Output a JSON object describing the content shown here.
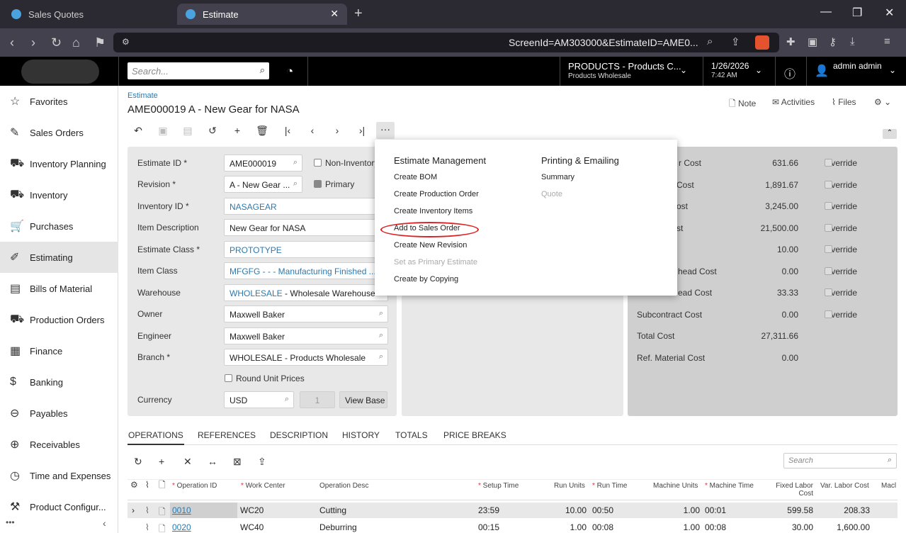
{
  "browser": {
    "tabs": [
      {
        "label": "Sales Quotes"
      },
      {
        "label": "Estimate"
      }
    ],
    "url_visible": "ScreenId=AM303000&EstimateID=AME0..."
  },
  "header": {
    "search_placeholder": "Search...",
    "company": "PRODUCTS - Products C...",
    "company_sub": "Products Wholesale",
    "date": "1/26/2026",
    "time": "7:42 AM",
    "user": "admin admin"
  },
  "sidebar": {
    "items": [
      {
        "label": "Favorites",
        "icon": "☆"
      },
      {
        "label": "Sales Orders",
        "icon": "✎"
      },
      {
        "label": "Inventory Planning",
        "icon": "⛟"
      },
      {
        "label": "Inventory",
        "icon": "⛟"
      },
      {
        "label": "Purchases",
        "icon": "🛒"
      },
      {
        "label": "Estimating",
        "icon": "✐"
      },
      {
        "label": "Bills of Material",
        "icon": "▤"
      },
      {
        "label": "Production Orders",
        "icon": "⛟"
      },
      {
        "label": "Finance",
        "icon": "▦"
      },
      {
        "label": "Banking",
        "icon": "$"
      },
      {
        "label": "Payables",
        "icon": "⊖"
      },
      {
        "label": "Receivables",
        "icon": "⊕"
      },
      {
        "label": "Time and Expenses",
        "icon": "◷"
      },
      {
        "label": "Product Configur...",
        "icon": "⚒"
      }
    ]
  },
  "page": {
    "breadcrumb": "Estimate",
    "title": "AME000019 A - New Gear for NASA",
    "actions": {
      "note": "Note",
      "activities": "Activities",
      "files": "Files"
    }
  },
  "form": {
    "estimate_id_label": "Estimate ID *",
    "estimate_id": "AME000019",
    "non_inventory_label": "Non-Inventory",
    "revision_label": "Revision *",
    "revision": "A - New Gear ...",
    "primary_label": "Primary",
    "inventory_id_label": "Inventory ID *",
    "inventory_id": "NASAGEAR",
    "item_desc_label": "Item Description",
    "item_desc": "New Gear for NASA",
    "estimate_class_label": "Estimate Class *",
    "estimate_class": "PROTOTYPE",
    "item_class_label": "Item Class",
    "item_class": "MFGFG - - - Manufacturing Finished ...",
    "warehouse_label": "Warehouse",
    "warehouse_code": "WHOLESALE",
    "warehouse_desc": " - Wholesale Warehouse",
    "owner_label": "Owner",
    "owner": "Maxwell Baker",
    "engineer_label": "Engineer",
    "engineer": "Maxwell Baker",
    "branch_label": "Branch *",
    "branch": "WHOLESALE - Products Wholesale",
    "round_label": "Round Unit Prices",
    "currency_label": "Currency",
    "currency": "USD",
    "rate": "1",
    "view_base": "View Base"
  },
  "costs": [
    {
      "label": "r Cost",
      "value": "631.66",
      "override": "Override"
    },
    {
      "label": "Cost",
      "value": "1,891.67",
      "override": "Override"
    },
    {
      "label": "ost",
      "value": "3,245.00",
      "override": "Override"
    },
    {
      "label": "st",
      "value": "21,500.00",
      "override": "Override"
    },
    {
      "label": "",
      "value": "10.00",
      "override": "Override"
    },
    {
      "label": "head Cost",
      "value": "0.00",
      "override": "Override"
    },
    {
      "label": "ead Cost",
      "value": "33.33",
      "override": "Override"
    },
    {
      "label": "Subcontract Cost",
      "value": "0.00",
      "override": "Override"
    },
    {
      "label": "Total Cost",
      "value": "27,311.66",
      "override": ""
    },
    {
      "label": "Ref. Material Cost",
      "value": "0.00",
      "override": ""
    }
  ],
  "menu": {
    "col1_title": "Estimate Management",
    "col1": [
      {
        "label": "Create BOM",
        "enabled": true
      },
      {
        "label": "Create Production Order",
        "enabled": true
      },
      {
        "label": "Create Inventory Items",
        "enabled": true
      },
      {
        "label": "Add to Sales Order",
        "enabled": true
      },
      {
        "label": "Create New Revision",
        "enabled": true
      },
      {
        "label": "Set as Primary Estimate",
        "enabled": false
      },
      {
        "label": "Create by Copying",
        "enabled": true
      }
    ],
    "col2_title": "Printing & Emailing",
    "col2": [
      {
        "label": "Summary",
        "enabled": true
      },
      {
        "label": "Quote",
        "enabled": false
      }
    ]
  },
  "tabs": [
    "OPERATIONS",
    "REFERENCES",
    "DESCRIPTION",
    "HISTORY",
    "TOTALS",
    "PRICE BREAKS"
  ],
  "grid": {
    "search_placeholder": "Search",
    "headers": [
      "Operation ID",
      "Work Center",
      "Operation Desc",
      "Setup Time",
      "Run Units",
      "Run Time",
      "Machine Units",
      "Machine Time",
      "Fixed Labor Cost",
      "Var. Labor Cost",
      "Macl"
    ],
    "rows": [
      {
        "op": "0010",
        "wc": "WC20",
        "desc": "Cutting",
        "setup": "23:59",
        "run_units": "10.00",
        "run_time": "00:50",
        "mach_units": "1.00",
        "mach_time": "00:01",
        "fixed": "599.58",
        "var": "208.33"
      },
      {
        "op": "0020",
        "wc": "WC40",
        "desc": "Deburring",
        "setup": "00:15",
        "run_units": "1.00",
        "run_time": "00:08",
        "mach_units": "1.00",
        "mach_time": "00:08",
        "fixed": "30.00",
        "var": "1,600.00"
      }
    ]
  }
}
